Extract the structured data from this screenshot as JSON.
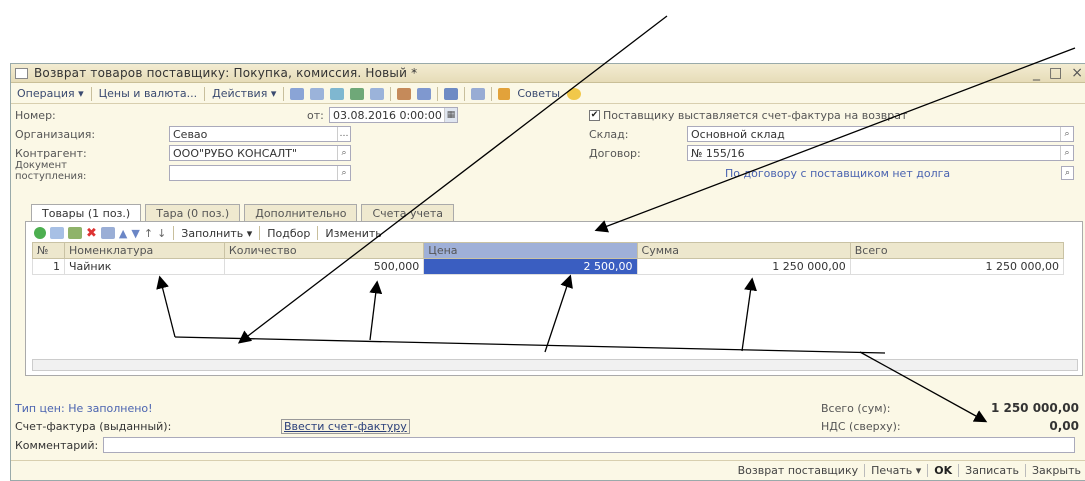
{
  "window": {
    "title": "Возврат товаров поставщику: Покупка, комиссия. Новый *",
    "controls": [
      "_",
      "□",
      "×"
    ]
  },
  "toolbar": {
    "operation": "Операция ▾",
    "prices": "Цены и валюта...",
    "actions": "Действия ▾",
    "tips": "Советы"
  },
  "form": {
    "number_label": "Номер:",
    "number_value": "",
    "date_label": "от:",
    "date_value": "03.08.2016 0:00:00",
    "supplier_invoice_label": "Поставщику выставляется счет-фактура на возврат",
    "org_label": "Организация:",
    "org_value": "Севао",
    "warehouse_label": "Склад:",
    "warehouse_value": "Основной склад",
    "counterparty_label": "Контрагент:",
    "counterparty_value": "ООО\"РУБО КОНСАЛТ\"",
    "contract_label": "Договор:",
    "contract_value": "№ 155/16",
    "receipt_doc_label_1": "Документ",
    "receipt_doc_label_2": "поступления:",
    "receipt_doc_value": "",
    "debt_link": "По договору с поставщиком нет долга"
  },
  "tabs": [
    {
      "label": "Товары (1 поз.)",
      "active": true
    },
    {
      "label": "Тара (0 поз.)",
      "active": false
    },
    {
      "label": "Дополнительно",
      "active": false
    },
    {
      "label": "Счета учета",
      "active": false
    }
  ],
  "subtoolbar": {
    "fill": "Заполнить ▾",
    "select": "Подбор",
    "change": "Изменить"
  },
  "table": {
    "headers": [
      "№",
      "Номенклатура",
      "Количество",
      "Цена",
      "Сумма",
      "Всего"
    ],
    "rows": [
      [
        "1",
        "Чайник",
        "500,000",
        "2 500,00",
        "1 250 000,00",
        "1 250 000,00"
      ]
    ]
  },
  "footer": {
    "price_type": "Тип цен: Не заполнено!",
    "invoice_label": "Счет-фактура (выданный):",
    "invoice_button": "Ввести счет-фактуру",
    "total_label": "Всего (сум):",
    "total_value": "1 250 000,00",
    "vat_label": "НДС (сверху):",
    "vat_value": "0,00",
    "comment_label": "Комментарий:",
    "comment_value": ""
  },
  "actions": {
    "return": "Возврат поставщику",
    "print": "Печать ▾",
    "ok": "OK",
    "save": "Записать",
    "close": "Закрыть"
  },
  "icons": [
    "document-icon",
    "table-icon",
    "calendar-icon",
    "tips-icon",
    "help-icon",
    "add-icon",
    "copy-icon",
    "edit-icon",
    "delete-icon",
    "sort-icon"
  ],
  "colors": {
    "accent": "#3a5ec1",
    "window_bg": "#fbf8e6",
    "link": "#2a3f7a"
  }
}
